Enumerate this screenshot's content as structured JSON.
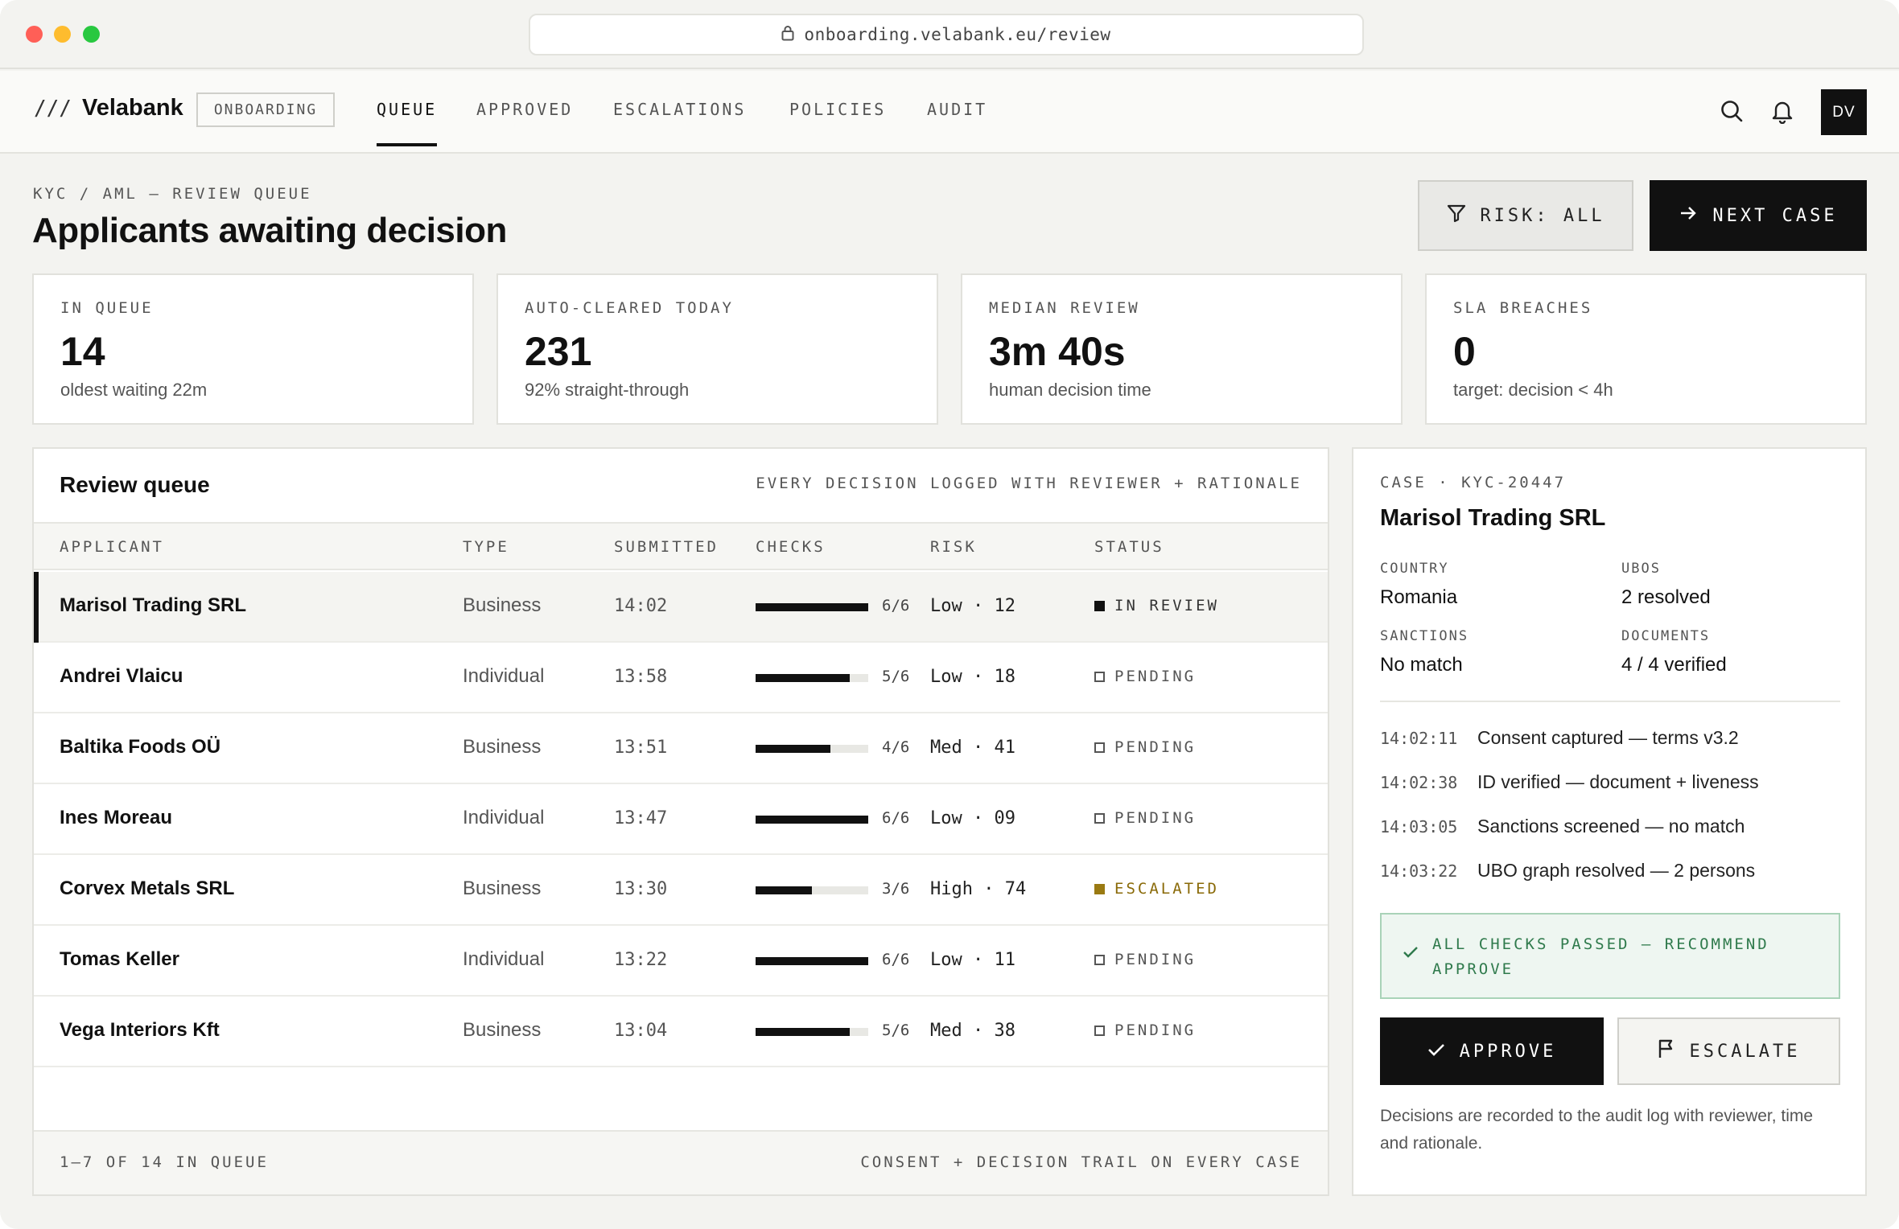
{
  "browser": {
    "url": "onboarding.velabank.eu/review",
    "dot_colors": [
      "#ff5f57",
      "#febc2e",
      "#28c840"
    ]
  },
  "nav": {
    "brand_mark": "///",
    "brand": "Velabank",
    "tag": "ONBOARDING",
    "tabs": [
      "QUEUE",
      "APPROVED",
      "ESCALATIONS",
      "POLICIES",
      "AUDIT"
    ],
    "active_tab": "QUEUE",
    "avatar": "DV"
  },
  "header": {
    "breadcrumb": "KYC / AML — REVIEW QUEUE",
    "title": "Applicants awaiting decision",
    "risk_filter": "RISK: ALL",
    "next_case": "NEXT CASE"
  },
  "stats": [
    {
      "label": "IN QUEUE",
      "value": "14",
      "sub": "oldest waiting 22m"
    },
    {
      "label": "AUTO-CLEARED TODAY",
      "value": "231",
      "sub": "92% straight-through"
    },
    {
      "label": "MEDIAN REVIEW",
      "value": "3m 40s",
      "sub": "human decision time"
    },
    {
      "label": "SLA BREACHES",
      "value": "0",
      "sub": "target: decision < 4h"
    }
  ],
  "queue": {
    "title": "Review queue",
    "note": "EVERY DECISION LOGGED WITH REVIEWER + RATIONALE",
    "columns": [
      "APPLICANT",
      "TYPE",
      "SUBMITTED",
      "CHECKS",
      "RISK",
      "STATUS"
    ],
    "rows": [
      {
        "name": "Marisol Trading SRL",
        "type": "Business",
        "submitted": "14:02",
        "checks": "6/6",
        "checks_passed": 6,
        "checks_total": 6,
        "risk": "Low · 12",
        "status": "IN REVIEW",
        "status_kind": "review",
        "selected": true
      },
      {
        "name": "Andrei Vlaicu",
        "type": "Individual",
        "submitted": "13:58",
        "checks": "5/6",
        "checks_passed": 5,
        "checks_total": 6,
        "risk": "Low · 18",
        "status": "PENDING",
        "status_kind": "pending"
      },
      {
        "name": "Baltika Foods OÜ",
        "type": "Business",
        "submitted": "13:51",
        "checks": "4/6",
        "checks_passed": 4,
        "checks_total": 6,
        "risk": "Med · 41",
        "status": "PENDING",
        "status_kind": "pending"
      },
      {
        "name": "Ines Moreau",
        "type": "Individual",
        "submitted": "13:47",
        "checks": "6/6",
        "checks_passed": 6,
        "checks_total": 6,
        "risk": "Low · 09",
        "status": "PENDING",
        "status_kind": "pending"
      },
      {
        "name": "Corvex Metals SRL",
        "type": "Business",
        "submitted": "13:30",
        "checks": "3/6",
        "checks_passed": 3,
        "checks_total": 6,
        "risk": "High · 74",
        "status": "ESCALATED",
        "status_kind": "escalated"
      },
      {
        "name": "Tomas Keller",
        "type": "Individual",
        "submitted": "13:22",
        "checks": "6/6",
        "checks_passed": 6,
        "checks_total": 6,
        "risk": "Low · 11",
        "status": "PENDING",
        "status_kind": "pending"
      },
      {
        "name": "Vega Interiors Kft",
        "type": "Business",
        "submitted": "13:04",
        "checks": "5/6",
        "checks_passed": 5,
        "checks_total": 6,
        "risk": "Med · 38",
        "status": "PENDING",
        "status_kind": "pending"
      }
    ],
    "footer_left": "1–7 OF 14 IN QUEUE",
    "footer_right": "CONSENT + DECISION TRAIL ON EVERY CASE"
  },
  "case": {
    "id_label": "CASE · KYC-20447",
    "title": "Marisol Trading SRL",
    "fields": [
      {
        "label": "COUNTRY",
        "value": "Romania"
      },
      {
        "label": "UBOS",
        "value": "2 resolved"
      },
      {
        "label": "SANCTIONS",
        "value": "No match"
      },
      {
        "label": "DOCUMENTS",
        "value": "4 / 4 verified"
      }
    ],
    "events": [
      {
        "time": "14:02:11",
        "desc": "Consent captured — terms v3.2"
      },
      {
        "time": "14:02:38",
        "desc": "ID verified — document + liveness"
      },
      {
        "time": "14:03:05",
        "desc": "Sanctions screened — no match"
      },
      {
        "time": "14:03:22",
        "desc": "UBO graph resolved — 2 persons"
      }
    ],
    "recommendation": "ALL CHECKS PASSED — RECOMMEND APPROVE",
    "approve": "APPROVE",
    "escalate": "ESCALATE",
    "note": "Decisions are recorded to the audit log with reviewer, time and rationale."
  }
}
